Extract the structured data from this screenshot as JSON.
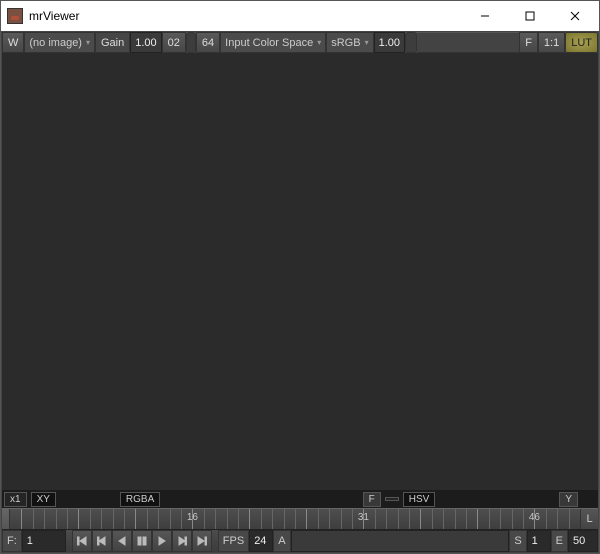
{
  "window": {
    "title": "mrViewer"
  },
  "toolbar": {
    "w_btn": "W",
    "image_name": "(no image)",
    "gain_label": "Gain",
    "gain_value": "1.00",
    "exp_step": "02",
    "exp_value": "64",
    "ics_label": "Input Color Space",
    "ics_value": "sRGB",
    "gamma_value": "1.00",
    "f_btn": "F",
    "ratio_btn": "1:1",
    "lut_btn": "LUT"
  },
  "infobar": {
    "zoom": "x1",
    "coord_mode": "XY",
    "channels": "RGBA",
    "f_label": "F",
    "color_mode": "HSV",
    "y_label": "Y"
  },
  "timeline": {
    "ticks": [
      {
        "n": 1,
        "pct": 2
      },
      {
        "n": 6,
        "pct": 12
      },
      {
        "n": 11,
        "pct": 22
      },
      {
        "n": 16,
        "pct": 32,
        "label": true
      },
      {
        "n": 21,
        "pct": 42
      },
      {
        "n": 26,
        "pct": 52
      },
      {
        "n": 31,
        "pct": 62,
        "label": true
      },
      {
        "n": 36,
        "pct": 72
      },
      {
        "n": 41,
        "pct": 82
      },
      {
        "n": 46,
        "pct": 92,
        "label": true
      }
    ],
    "end_label": "L"
  },
  "transport": {
    "f_label": "F:",
    "f_value": "1",
    "fps_label": "FPS",
    "fps_value": "24",
    "a_label": "A",
    "s_label": "S",
    "s_value": "1",
    "e_label": "E",
    "e_value": "50"
  }
}
